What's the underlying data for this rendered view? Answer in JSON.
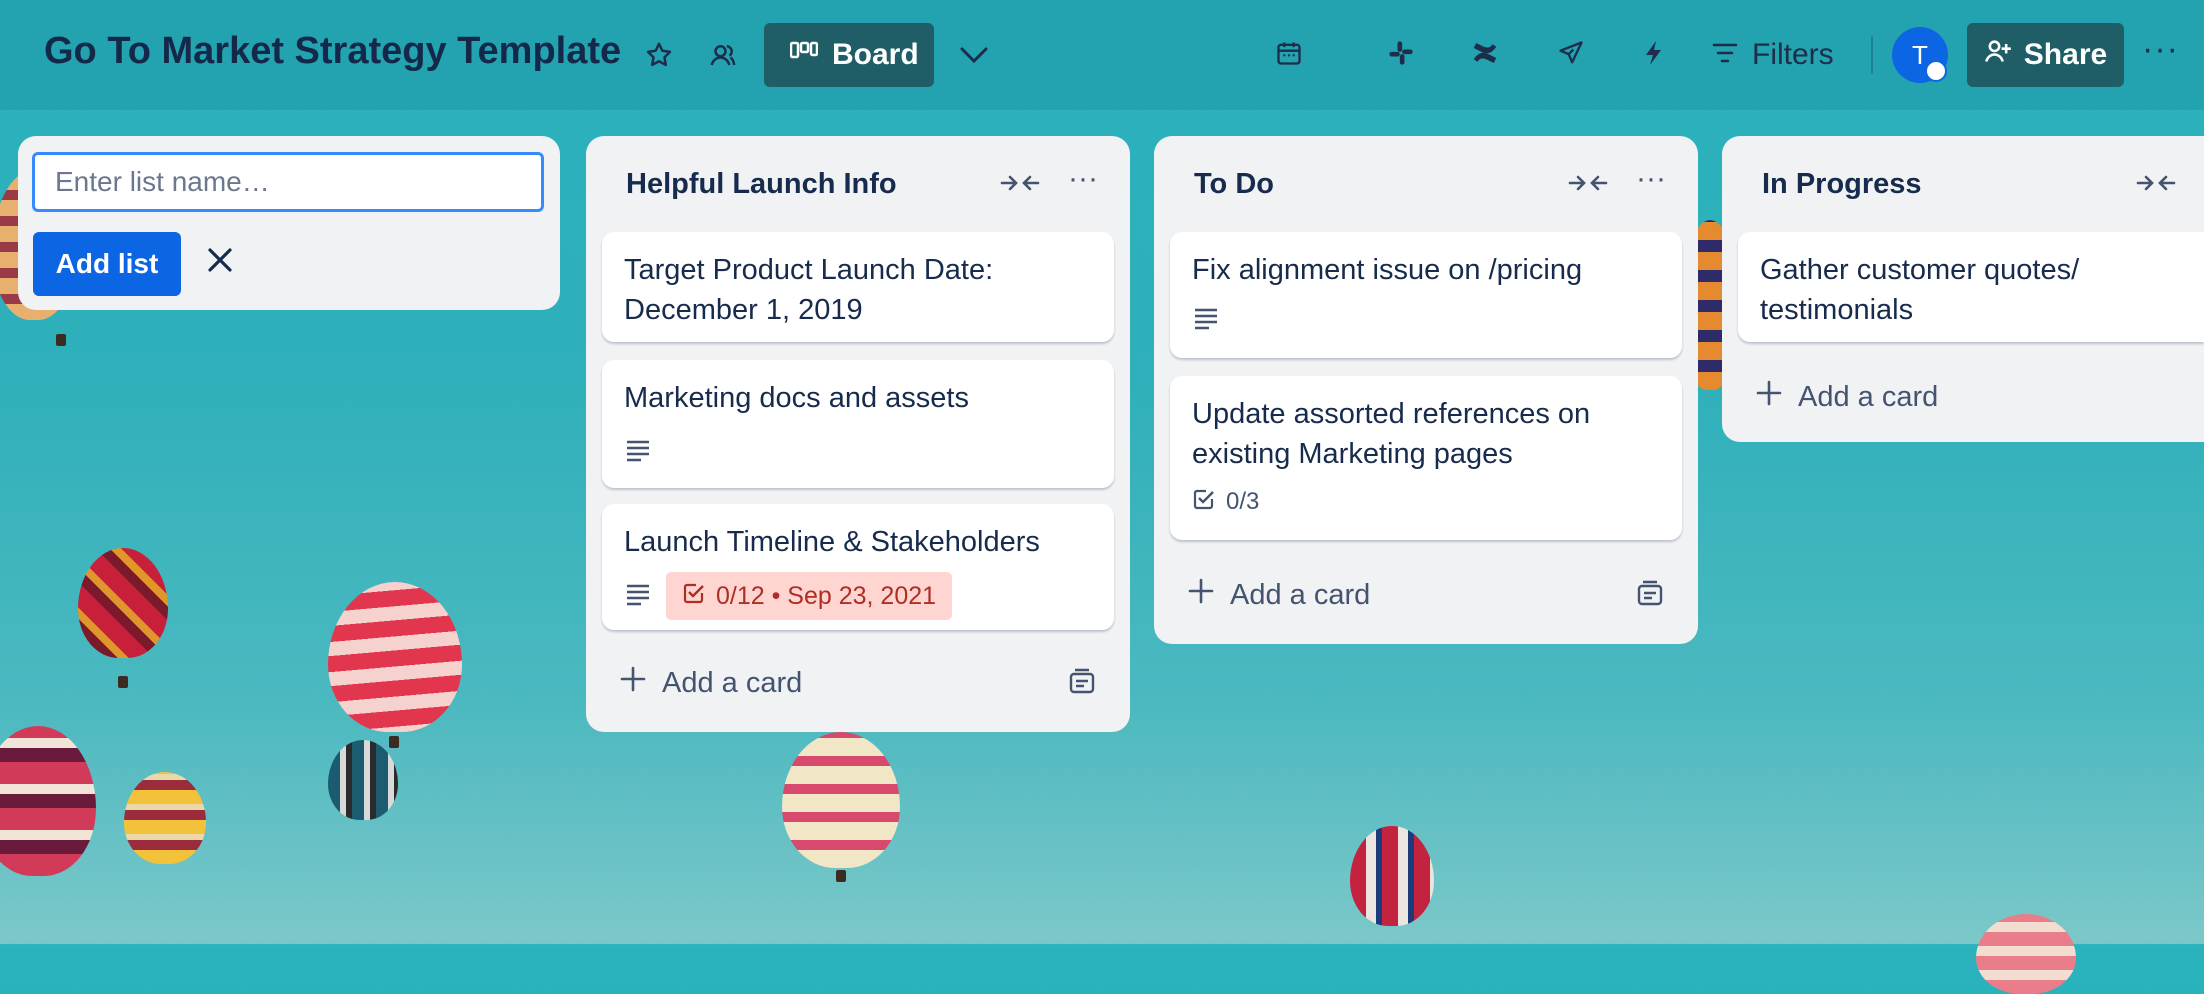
{
  "board": {
    "title": "Go To Market Strategy Template",
    "view_label": "Board",
    "filters_label": "Filters",
    "avatar_initial": "T",
    "share_label": "Share",
    "more_label": "···"
  },
  "composer": {
    "placeholder": "Enter list name…",
    "add_label": "Add list"
  },
  "lists": [
    {
      "title": "Helpful Launch Info",
      "cards": [
        {
          "title": "Target Product Launch Date: December 1, 2019"
        },
        {
          "title": "Marketing docs and assets"
        },
        {
          "title": "Launch Timeline & Stakeholders",
          "badge": "0/12 • Sep 23, 2021"
        }
      ],
      "add_label": "Add a card",
      "more_label": "···"
    },
    {
      "title": "To Do",
      "cards": [
        {
          "title": "Fix alignment issue on /pricing"
        },
        {
          "title": "Update assorted references on existing Marketing pages",
          "badge": "0/3"
        }
      ],
      "add_label": "Add a card",
      "more_label": "···"
    },
    {
      "title": "In Progress",
      "cards": [
        {
          "title": "Gather customer quotes/ testimonials"
        }
      ],
      "add_label": "Add a card"
    }
  ],
  "colors": {
    "accent": "#0c66e4",
    "header_button": "#1f5e66",
    "due_badge_bg": "#ffd5d2",
    "due_badge_text": "#ae2e24"
  },
  "icons": {
    "header": [
      "star-icon",
      "workspace-visibility-icon",
      "board-view-icon",
      "chevron-down-icon",
      "calendar-icon",
      "slack-icon",
      "confluence-icon",
      "rocket-icon",
      "automation-icon",
      "filter-icon",
      "add-person-icon"
    ],
    "card": [
      "description-icon",
      "checklist-icon"
    ],
    "list": [
      "collapse-icon",
      "more-icon",
      "plus-icon",
      "template-icon"
    ]
  }
}
